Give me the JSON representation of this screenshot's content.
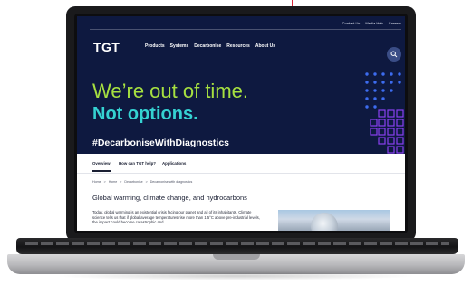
{
  "site": {
    "logo": "TGT",
    "utility_links": [
      "Contact Us",
      "Media Hub",
      "Careers"
    ],
    "nav": [
      "Products",
      "Systems",
      "Decarbonise",
      "Resources",
      "About Us"
    ]
  },
  "hero": {
    "headline_1": "We’re out of time.",
    "headline_2": "Not options.",
    "hashtag": "#DecarboniseWithDiagnostics",
    "colors": {
      "background": "#0e1940",
      "headline_1": "#a6e040",
      "headline_2": "#35d2d2",
      "accent": "#7b3ff2"
    }
  },
  "tabs": [
    "Overview",
    "How can TGT help?",
    "Applications"
  ],
  "breadcrumb": [
    "Home",
    ">",
    "Home",
    ">",
    "Decarbonise",
    ">",
    "Decarbonise with diagnostics"
  ],
  "content": {
    "title": "Global warming, climate change, and hydrocarbons",
    "body": "Today, global warming is an existential crisis facing our planet and all of its inhabitants. Climate science tells us that if global average temperatures rise more than 1.5°C above pre-industrial levels, the impact could become catastrophic and"
  },
  "icons": {
    "search": "search-icon"
  }
}
